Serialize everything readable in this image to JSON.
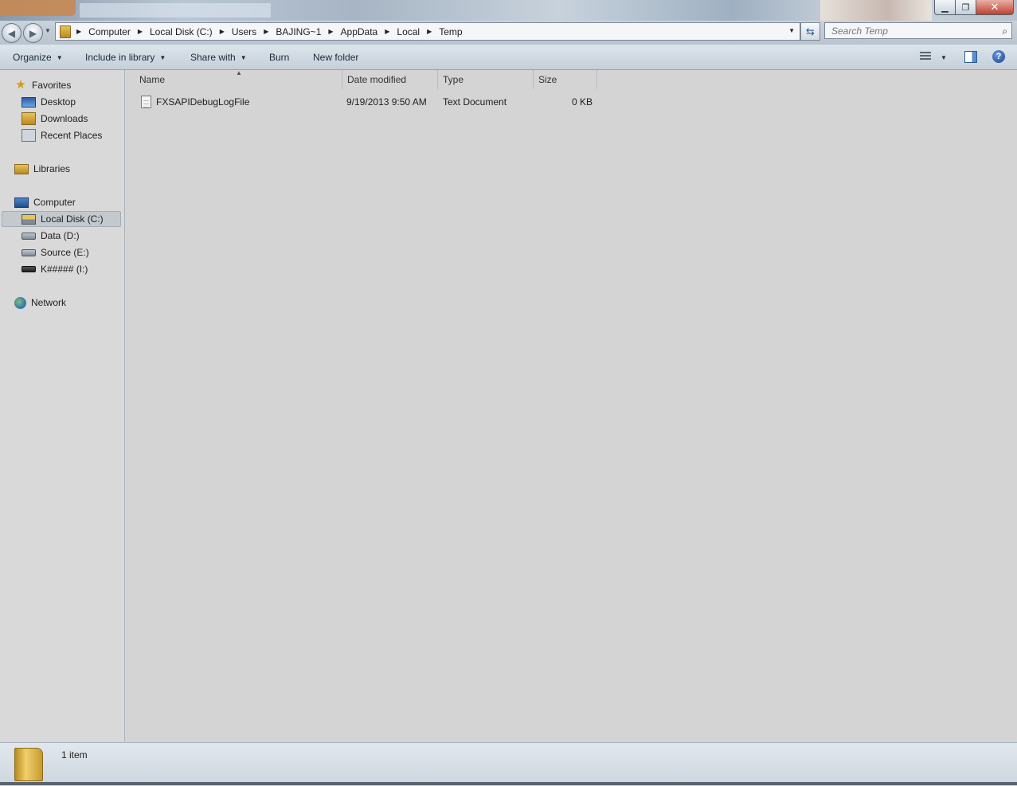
{
  "window": {
    "minimize_icon": "minimize-icon",
    "maximize_icon": "restore-icon",
    "close_icon": "close-icon"
  },
  "address": {
    "crumbs": [
      "Computer",
      "Local Disk (C:)",
      "Users",
      "BAJING~1",
      "AppData",
      "Local",
      "Temp"
    ]
  },
  "search": {
    "placeholder": "Search Temp"
  },
  "toolbar": {
    "organize": "Organize",
    "include_in_library": "Include in library",
    "share_with": "Share with",
    "burn": "Burn",
    "new_folder": "New folder"
  },
  "navpane": {
    "favorites": "Favorites",
    "desktop": "Desktop",
    "downloads": "Downloads",
    "recent_places": "Recent Places",
    "libraries": "Libraries",
    "computer": "Computer",
    "drives": [
      "Local Disk (C:)",
      "Data (D:)",
      "Source (E:)",
      "K##### (I:)"
    ],
    "network": "Network",
    "selected": "Local Disk (C:)"
  },
  "columns": {
    "name": "Name",
    "date_modified": "Date modified",
    "type": "Type",
    "size": "Size"
  },
  "files": [
    {
      "name": "FXSAPIDebugLogFile",
      "date_modified": "9/19/2013 9:50 AM",
      "type": "Text Document",
      "size": "0 KB"
    }
  ],
  "status": {
    "item_count": "1 item"
  }
}
